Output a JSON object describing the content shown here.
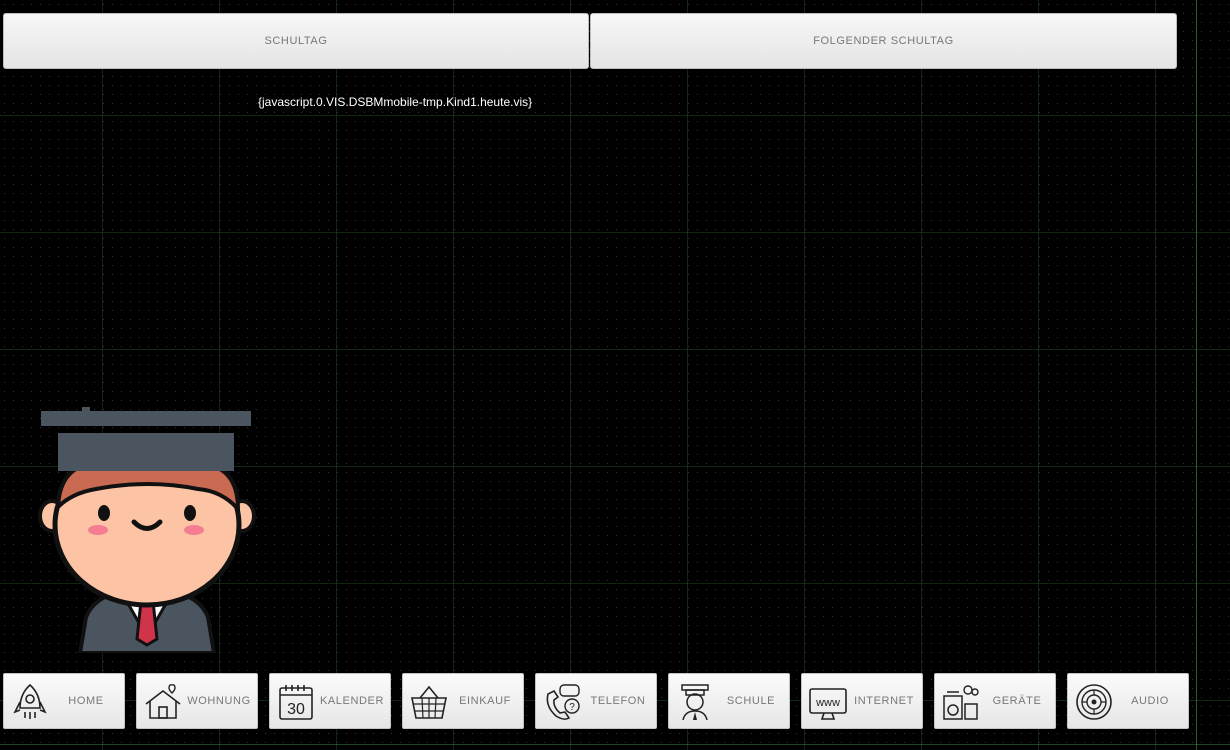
{
  "top_buttons": {
    "schultag": "SCHULTAG",
    "folgender_schultag": "FOLGENDER SCHULTAG"
  },
  "binding_text": "{javascript.0.VIS.DSBMmobile-tmp.Kind1.heute.vis}",
  "nav": [
    {
      "label": "HOME",
      "icon": "rocket-icon"
    },
    {
      "label": "WOHNUNG",
      "icon": "house-heart-icon"
    },
    {
      "label": "KALENDER",
      "icon": "calendar-icon",
      "icon_text": "30"
    },
    {
      "label": "EINKAUF",
      "icon": "basket-icon"
    },
    {
      "label": "TELEFON",
      "icon": "phone-chat-icon"
    },
    {
      "label": "SCHULE",
      "icon": "student-icon"
    },
    {
      "label": "INTERNET",
      "icon": "www-monitor-icon",
      "icon_text": "www"
    },
    {
      "label": "GERÄTE",
      "icon": "appliances-icon"
    },
    {
      "label": "AUDIO",
      "icon": "speaker-icon"
    }
  ],
  "colors": {
    "background": "#000000",
    "button_face": "#eeeeee",
    "button_text": "#777777",
    "mascot_cap": "#4a5560",
    "mascot_skin": "#fcc4a4",
    "mascot_hair": "#c96a52",
    "mascot_tie": "#d0344a"
  }
}
